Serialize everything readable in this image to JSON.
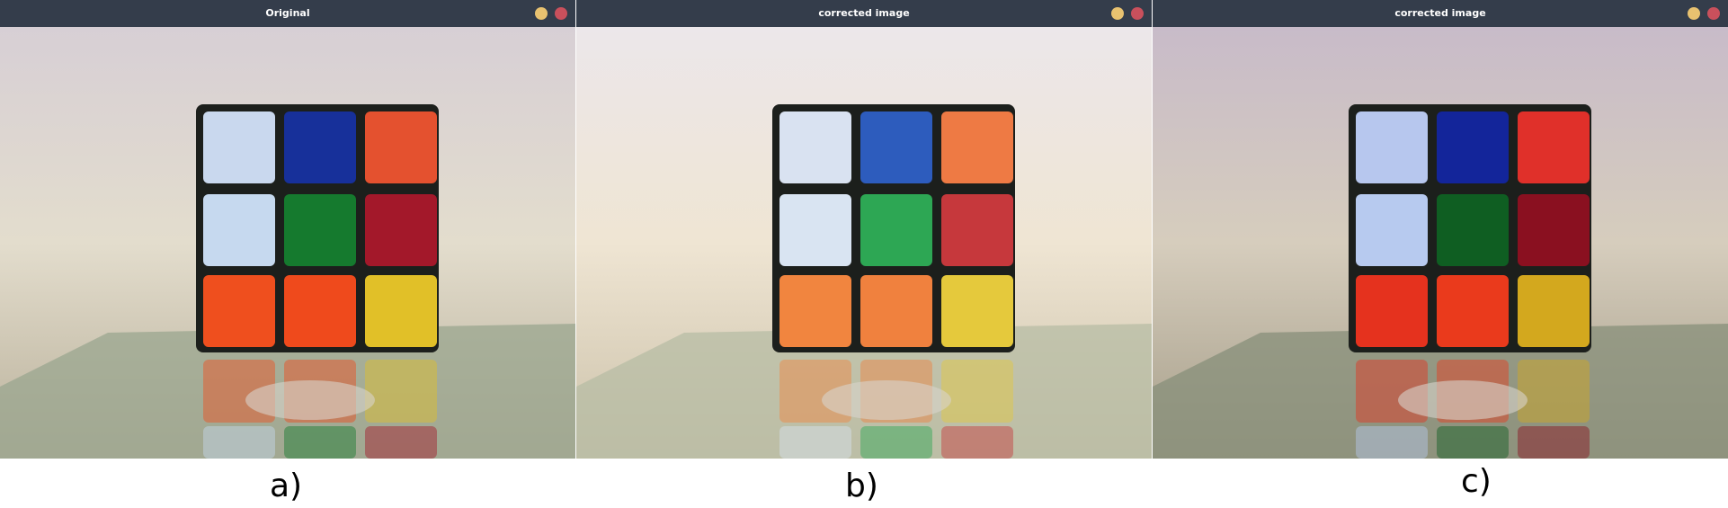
{
  "windows": [
    {
      "title": "Original",
      "bg": [
        "#d7cfd5",
        "#e3ddcd",
        "#b9b09a"
      ],
      "glass": "#9aa58f",
      "stickers": [
        "#c9d8ee",
        "#17309a",
        "#e4512f",
        "#c6d9ef",
        "#157a2e",
        "#a3182a",
        "#ef4f1e",
        "#ef4a1c",
        "#e1c028"
      ],
      "icons": [
        "minimize-icon",
        "close-icon"
      ]
    },
    {
      "title": "corrected image",
      "bg": [
        "#ece7ea",
        "#efe5d3",
        "#cbc1a9"
      ],
      "glass": "#b7bca4",
      "stickers": [
        "#d9e2f1",
        "#2d5cbd",
        "#ee7a44",
        "#d9e4f2",
        "#2da754",
        "#c6383c",
        "#f1853f",
        "#f0813e",
        "#e5c93c"
      ],
      "icons": [
        "minimize-icon",
        "close-icon"
      ]
    },
    {
      "title": "corrected image",
      "bg": [
        "#c8bbc9",
        "#d6cdbd",
        "#a59d88"
      ],
      "glass": "#878f7a",
      "stickers": [
        "#b7c7ee",
        "#13259a",
        "#e0302a",
        "#b7caef",
        "#0f5e22",
        "#8a1020",
        "#e5321e",
        "#ea3a1c",
        "#d3a81e"
      ],
      "icons": [
        "minimize-icon",
        "close-icon"
      ]
    }
  ],
  "captions": [
    "a)",
    "b)",
    "c)"
  ]
}
